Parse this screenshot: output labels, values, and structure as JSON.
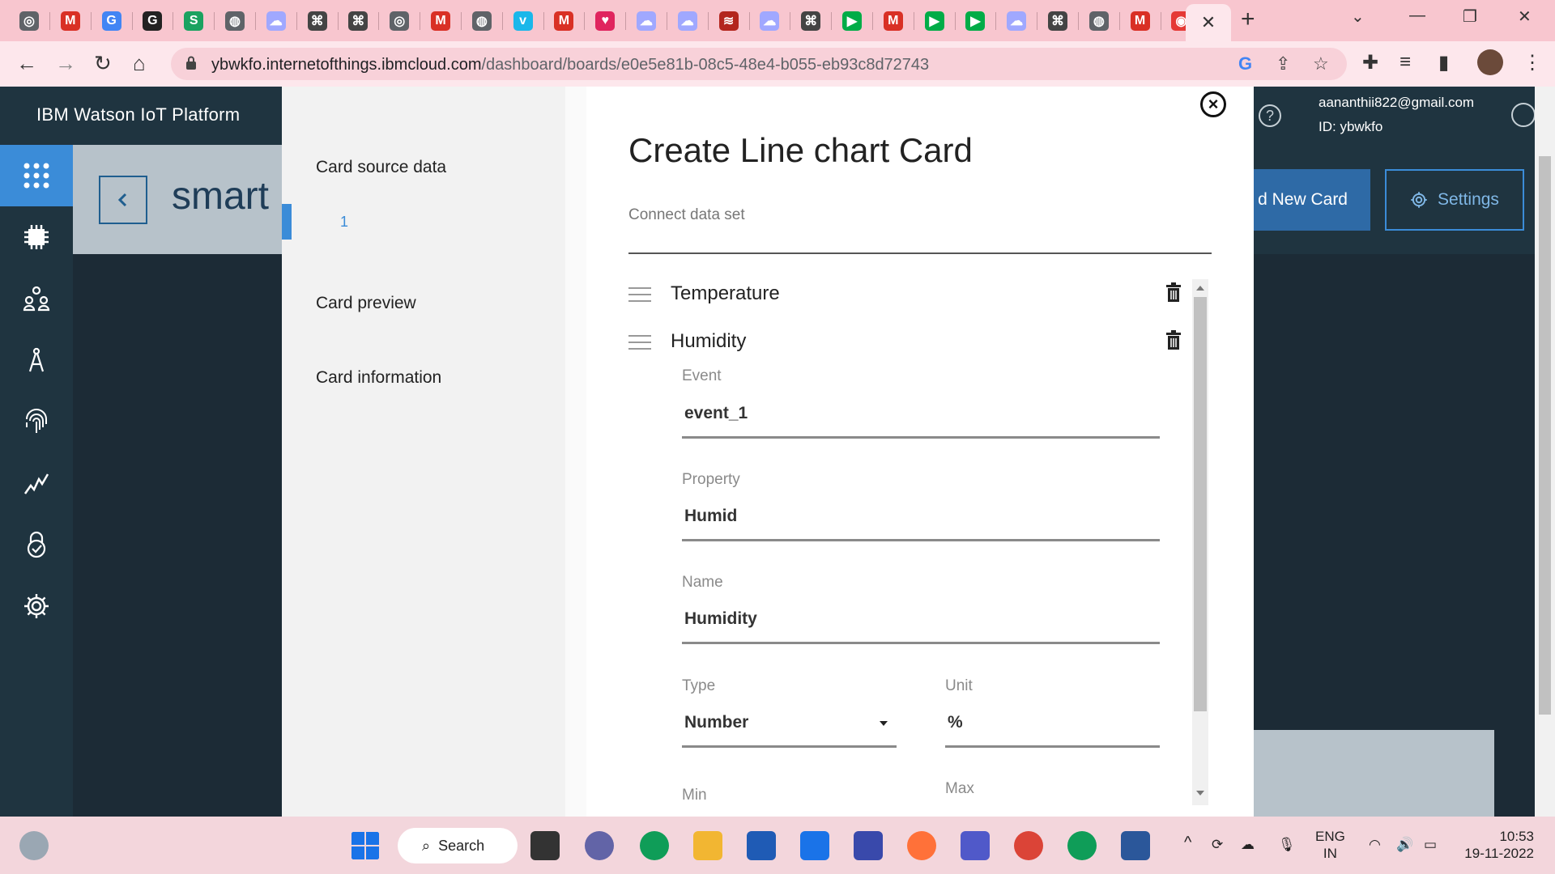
{
  "browser": {
    "tabs": [
      {
        "icon": "chrome-icon",
        "color": "#5f6368",
        "glyph": "◎"
      },
      {
        "icon": "gmail-icon",
        "color": "#d93025",
        "glyph": "M"
      },
      {
        "icon": "google-icon",
        "color": "#4285f4",
        "glyph": "G"
      },
      {
        "icon": "grammarly-icon",
        "color": "#222222",
        "glyph": "G"
      },
      {
        "icon": "s-icon",
        "color": "#1aa260",
        "glyph": "S"
      },
      {
        "icon": "globe-icon",
        "color": "#5f6368",
        "glyph": "◍"
      },
      {
        "icon": "cloud-icon",
        "color": "#a0a8ff",
        "glyph": "☁"
      },
      {
        "icon": "satellite-icon",
        "color": "#444444",
        "glyph": "⌘"
      },
      {
        "icon": "satellite-icon",
        "color": "#444444",
        "glyph": "⌘"
      },
      {
        "icon": "chrome-icon",
        "color": "#5f6368",
        "glyph": "◎"
      },
      {
        "icon": "gmail-icon",
        "color": "#d93025",
        "glyph": "M"
      },
      {
        "icon": "globe-icon",
        "color": "#5f6368",
        "glyph": "◍"
      },
      {
        "icon": "vimeo-icon",
        "color": "#1ab7ea",
        "glyph": "v"
      },
      {
        "icon": "gmail-icon",
        "color": "#d93025",
        "glyph": "M"
      },
      {
        "icon": "heart-icon",
        "color": "#e0245e",
        "glyph": "♥"
      },
      {
        "icon": "cloud-icon",
        "color": "#a0a8ff",
        "glyph": "☁"
      },
      {
        "icon": "cloud-icon",
        "color": "#a0a8ff",
        "glyph": "☁"
      },
      {
        "icon": "app-icon",
        "color": "#b3261e",
        "glyph": "≋"
      },
      {
        "icon": "cloud-icon",
        "color": "#a0a8ff",
        "glyph": "☁"
      },
      {
        "icon": "satellite-icon",
        "color": "#444444",
        "glyph": "⌘"
      },
      {
        "icon": "meet-icon",
        "color": "#00ac47",
        "glyph": "▶"
      },
      {
        "icon": "gmail-icon",
        "color": "#d93025",
        "glyph": "M"
      },
      {
        "icon": "meet-icon",
        "color": "#00ac47",
        "glyph": "▶"
      },
      {
        "icon": "meet-icon",
        "color": "#00ac47",
        "glyph": "▶"
      },
      {
        "icon": "cloud-icon",
        "color": "#a0a8ff",
        "glyph": "☁"
      },
      {
        "icon": "satellite-icon",
        "color": "#444444",
        "glyph": "⌘"
      },
      {
        "icon": "globe-icon",
        "color": "#5f6368",
        "glyph": "◍"
      },
      {
        "icon": "gmail-icon",
        "color": "#d93025",
        "glyph": "M"
      },
      {
        "icon": "record-icon",
        "color": "#e53935",
        "glyph": "◉"
      }
    ],
    "active_tab_close": "✕",
    "new_tab": "+",
    "url_host": "ybwkfo.internetofthings.ibmcloud.com",
    "url_path": "/dashboard/boards/e0e5e81b-08c5-48e4-b055-eb93c8d72743"
  },
  "app": {
    "brand": "IBM Watson IoT Platform",
    "help": "?",
    "user_email": "aananthii822@gmail.com",
    "user_id": "ID: ybwkfo",
    "board_title": "smart",
    "add_card": "d New Card",
    "settings": "Settings",
    "sidebar_icons": [
      "apps-grid-icon",
      "devices-chip-icon",
      "members-icon",
      "apps-compass-icon",
      "security-fingerprint-icon",
      "analytics-icon",
      "risk-lock-icon",
      "settings-gear-icon"
    ]
  },
  "modal": {
    "nav": {
      "source_data": "Card source data",
      "step_number": "1",
      "preview": "Card preview",
      "information": "Card information"
    },
    "title": "Create Line chart Card",
    "subtitle": "Connect data set",
    "datasets": [
      "Temperature",
      "Humidity"
    ],
    "fields": {
      "event_label": "Event",
      "event_value": "event_1",
      "property_label": "Property",
      "property_value": "Humid",
      "name_label": "Name",
      "name_value": "Humidity",
      "type_label": "Type",
      "type_value": "Number",
      "unit_label": "Unit",
      "unit_value": "%",
      "min_label": "Min",
      "max_label": "Max"
    }
  },
  "taskbar": {
    "search": "Search",
    "lang": "ENG",
    "region": "IN",
    "time": "10:53",
    "date": "19-11-2022"
  }
}
